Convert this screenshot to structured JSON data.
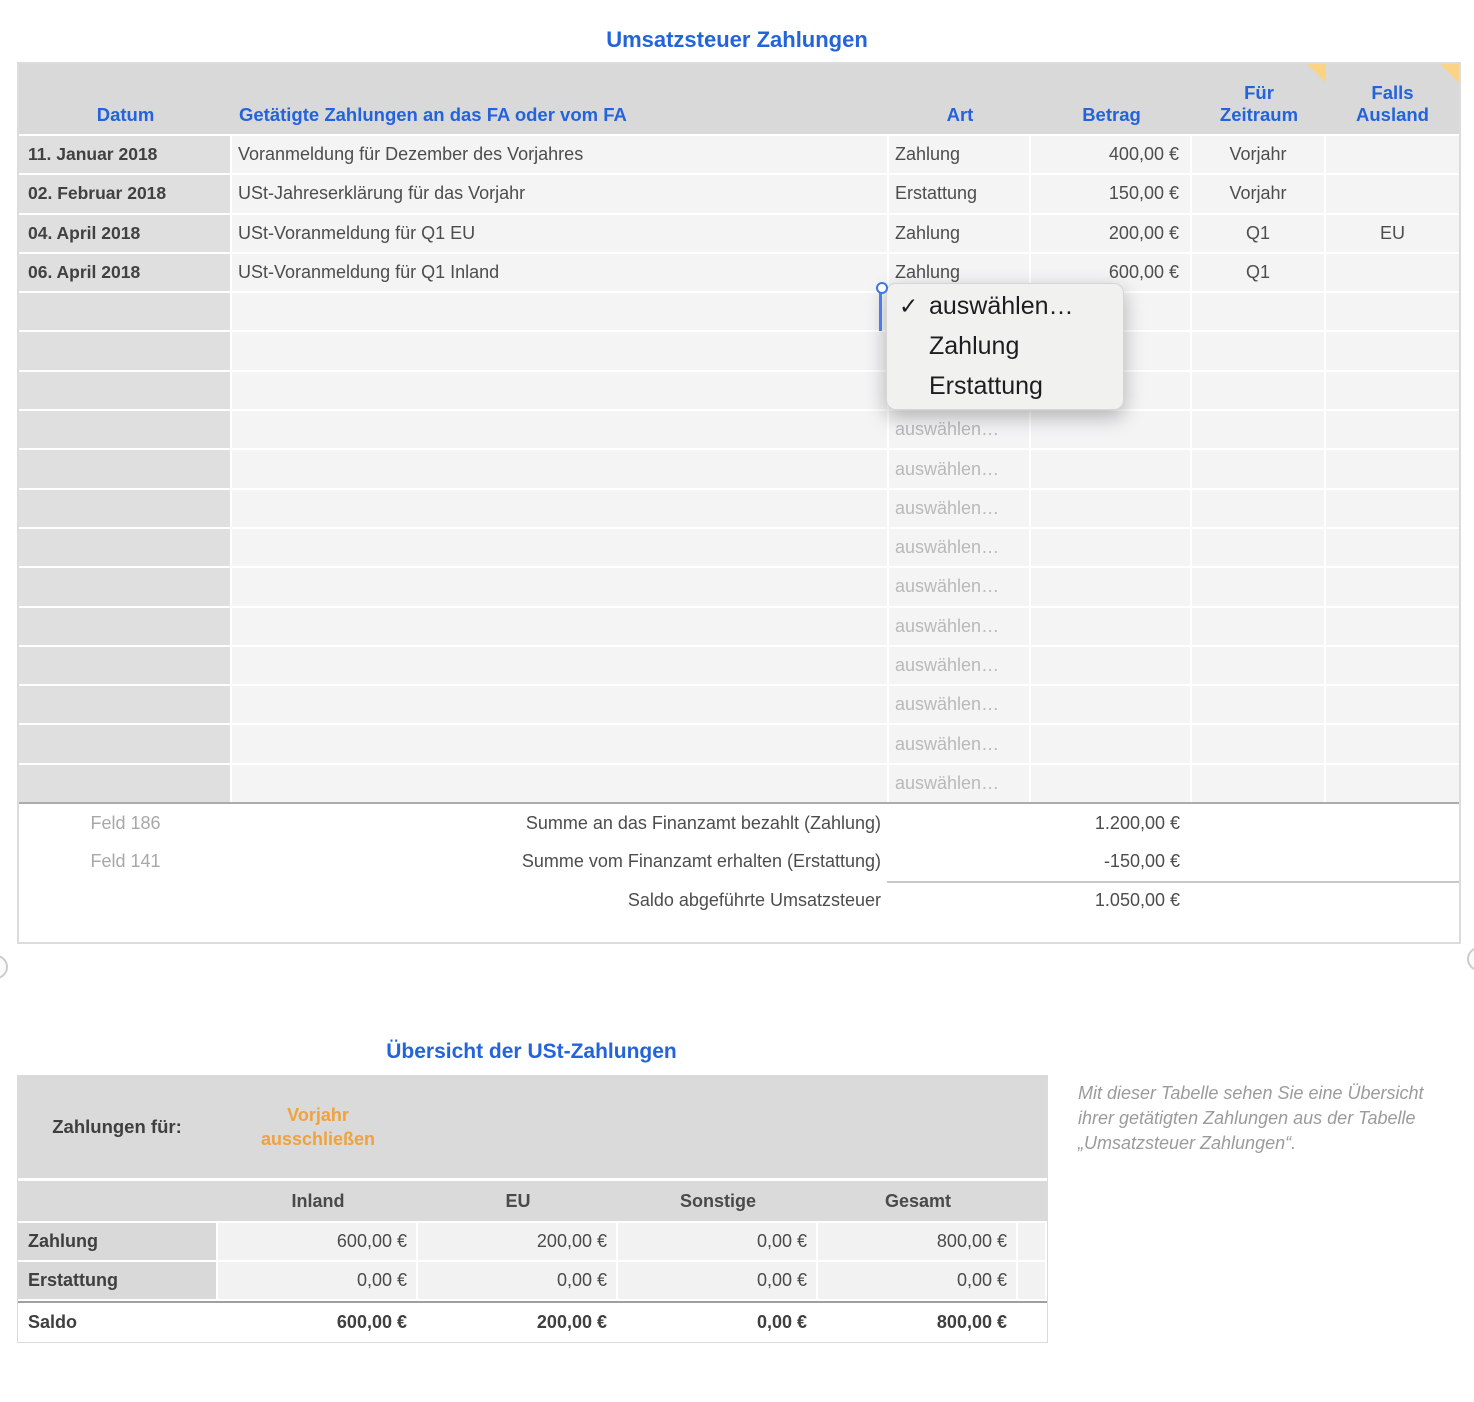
{
  "titles": {
    "table1": "Umsatzsteuer Zahlungen",
    "table2": "Übersicht der USt-Zahlungen"
  },
  "table1": {
    "headers": {
      "datum": "Datum",
      "beschreibung": "Getätigte Zahlungen an das FA oder vom FA",
      "art": "Art",
      "betrag": "Betrag",
      "zeitraum": "Für Zeitraum",
      "ausland": "Falls Ausland"
    },
    "rows": [
      {
        "datum": "11. Januar 2018",
        "beschreibung": "Voranmeldung für Dezember des Vorjahres",
        "art": "Zahlung",
        "betrag": "400,00 €",
        "zeitraum": "Vorjahr",
        "ausland": ""
      },
      {
        "datum": "02. Februar 2018",
        "beschreibung": "USt-Jahreserklärung für das Vorjahr",
        "art": "Erstattung",
        "betrag": "150,00 €",
        "zeitraum": "Vorjahr",
        "ausland": ""
      },
      {
        "datum": "04. April 2018",
        "beschreibung": "USt-Voranmeldung für Q1 EU",
        "art": "Zahlung",
        "betrag": "200,00 €",
        "zeitraum": "Q1",
        "ausland": "EU"
      },
      {
        "datum": "06. April 2018",
        "beschreibung": "USt-Voranmeldung für Q1 Inland",
        "art": "Zahlung",
        "betrag": "600,00 €",
        "zeitraum": "Q1",
        "ausland": ""
      }
    ],
    "empty_row_count": 13,
    "art_placeholder": "auswählen…",
    "footer": [
      {
        "feld": "Feld 186",
        "label": "Summe an das Finanzamt bezahlt (Zahlung)",
        "betrag": "1.200,00 €"
      },
      {
        "feld": "Feld 141",
        "label": "Summe vom Finanzamt erhalten (Erstattung)",
        "betrag": "-150,00 €"
      },
      {
        "feld": "",
        "label": "Saldo abgeführte Umsatzsteuer",
        "betrag": "1.050,00 €"
      }
    ]
  },
  "dropdown": {
    "check_glyph": "✓",
    "items": [
      "auswählen…",
      "Zahlung",
      "Erstattung"
    ],
    "selected_index": 0
  },
  "table2": {
    "filter_label": "Zahlungen für:",
    "filter_value": "Vorjahr ausschließen",
    "columns": [
      "Inland",
      "EU",
      "Sonstige",
      "Gesamt"
    ],
    "rows": [
      {
        "label": "Zahlung",
        "values": [
          "600,00 €",
          "200,00 €",
          "0,00 €",
          "800,00 €"
        ],
        "bold": false
      },
      {
        "label": "Erstattung",
        "values": [
          "0,00 €",
          "0,00 €",
          "0,00 €",
          "0,00 €"
        ],
        "bold": false
      },
      {
        "label": "Saldo",
        "values": [
          "600,00 €",
          "200,00 €",
          "0,00 €",
          "800,00 €"
        ],
        "bold": true
      }
    ]
  },
  "note": "Mit dieser Tabelle sehen Sie eine Übersicht ihrer getätigten Zahlungen aus der Tabelle „Umsatzsteuer Zahlungen“.",
  "colors": {
    "accent_blue": "#2363db",
    "accent_orange": "#efa23e",
    "comment_flag": "#fad387",
    "selection_blue": "#3f74e8"
  }
}
